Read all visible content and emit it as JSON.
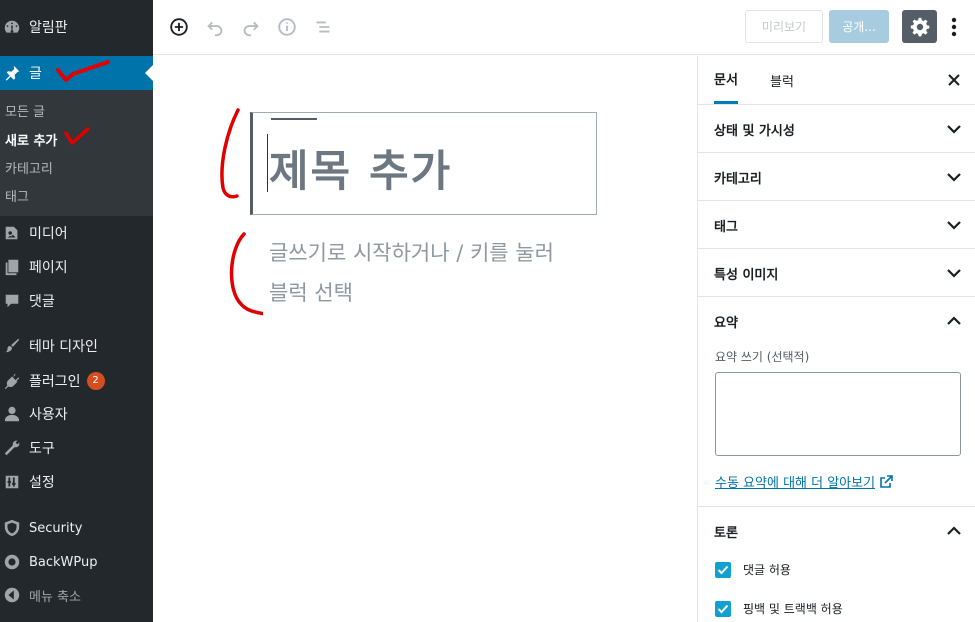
{
  "sidebar": {
    "dashboard": "알림판",
    "posts": "글",
    "posts_sub": [
      "모든 글",
      "새로 추가",
      "카테고리",
      "태그"
    ],
    "media": "미디어",
    "pages": "페이지",
    "comments": "댓글",
    "appearance": "테마 디자인",
    "plugins": "플러그인",
    "plugins_badge": "2",
    "users": "사용자",
    "tools": "도구",
    "settings": "설정",
    "security": "Security",
    "backwpup": "BackWPup",
    "collapse": "메뉴 축소"
  },
  "toolbar": {
    "preview_label": "미리보기",
    "publish_label": "공개..."
  },
  "editor": {
    "title_placeholder": "제목 추가",
    "body_placeholder": "글쓰기로 시작하거나 / 키를 눌러 블럭 선택"
  },
  "settings_panel": {
    "tab_document": "문서",
    "tab_block": "블럭",
    "sections": [
      "상태 및 가시성",
      "카테고리",
      "태그",
      "특성 이미지"
    ],
    "excerpt_title": "요약",
    "excerpt_label": "요약 쓰기 (선택적)",
    "excerpt_link": "수동 요약에 대해 더 알아보기",
    "discussion_title": "토론",
    "allow_comments": "댓글 허용",
    "allow_pingbacks": "핑백 및 트랙백 허용"
  },
  "colors": {
    "admin_bar": "#23282d",
    "active_menu": "#0073aa",
    "checkbox": "#11a0d2",
    "annotation": "#e00000"
  }
}
